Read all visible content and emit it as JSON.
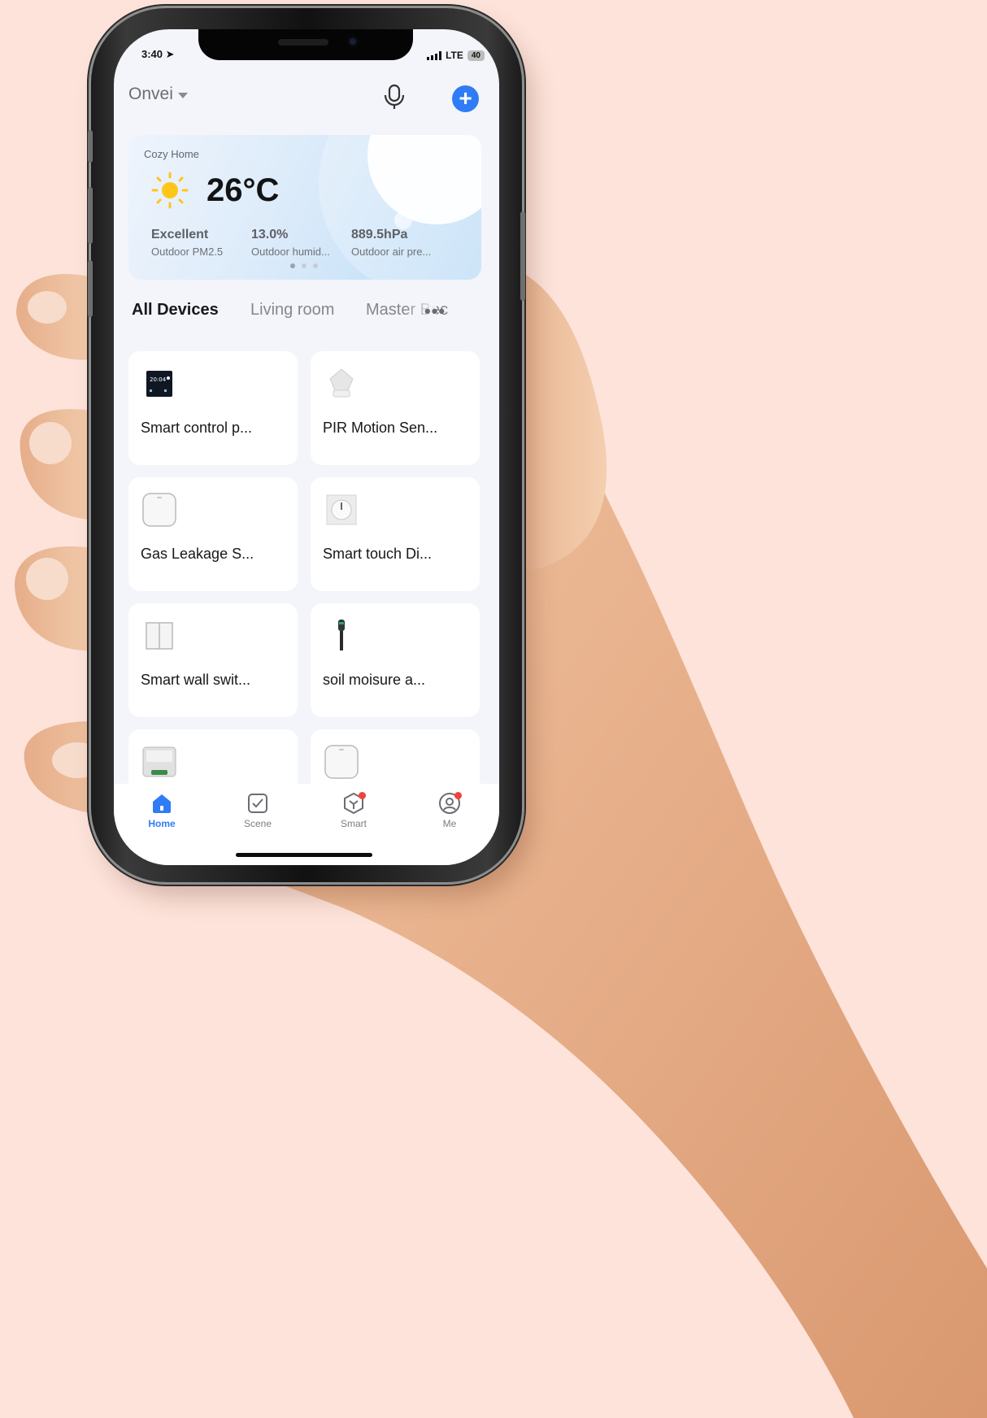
{
  "status_bar": {
    "time": "3:40",
    "network": "LTE",
    "battery": "40"
  },
  "header": {
    "home_name": "Onvei"
  },
  "weather": {
    "place": "Cozy Home",
    "temperature": "26°C",
    "stats": [
      {
        "value": "Excellent",
        "label": "Outdoor PM2.5"
      },
      {
        "value": "13.0%",
        "label": "Outdoor humid..."
      },
      {
        "value": "889.5hPa",
        "label": "Outdoor air pre..."
      }
    ],
    "page_count": 3,
    "current_page": 1
  },
  "rooms": {
    "tabs": [
      "All Devices",
      "Living room",
      "Master Bec"
    ],
    "active": "All Devices"
  },
  "devices": [
    {
      "name": "Smart control p..."
    },
    {
      "name": "PIR Motion Sen..."
    },
    {
      "name": "Gas Leakage S..."
    },
    {
      "name": "Smart touch Di..."
    },
    {
      "name": "Smart wall swit..."
    },
    {
      "name": "soil moisure a..."
    }
  ],
  "tabbar": {
    "items": [
      {
        "label": "Home",
        "icon": "home-icon",
        "active": true
      },
      {
        "label": "Scene",
        "icon": "scene-icon",
        "active": false
      },
      {
        "label": "Smart",
        "icon": "smart-icon",
        "active": false,
        "badge": true
      },
      {
        "label": "Me",
        "icon": "profile-icon",
        "active": false,
        "badge": true
      }
    ]
  },
  "colors": {
    "accent": "#2f7cf6",
    "background": "#fde3da",
    "badge": "#f1433a"
  }
}
